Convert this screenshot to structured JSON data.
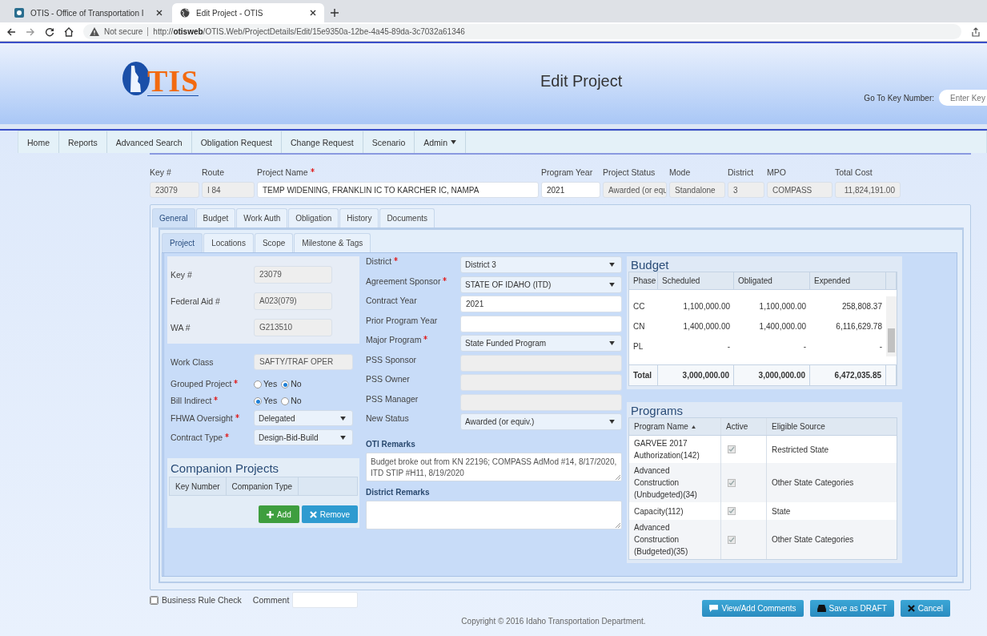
{
  "browser": {
    "tabs": [
      {
        "title": "OTIS - Office of Transportation I",
        "selected": false
      },
      {
        "title": "Edit Project - OTIS",
        "selected": true
      }
    ],
    "security": "Not secure",
    "url": "http://**otisweb**/OTIS.Web/ProjectDetails/Edit/15e9350a-12be-4a45-89da-3c7032a61346"
  },
  "header": {
    "logo_text": "TIS",
    "title": "Edit Project",
    "goto_label": "Go To Key Number:",
    "goto_placeholder": "Enter Key"
  },
  "nav": [
    {
      "label": "Home",
      "has_menu": false
    },
    {
      "label": "Reports",
      "has_menu": false
    },
    {
      "label": "Advanced Search",
      "has_menu": false
    },
    {
      "label": "Obligation Request",
      "has_menu": false
    },
    {
      "label": "Change Request",
      "has_menu": false
    },
    {
      "label": "Scenario",
      "has_menu": false
    },
    {
      "label": "Admin",
      "has_menu": true
    }
  ],
  "summary": [
    {
      "label": "Key #",
      "required": false,
      "value": "23079",
      "disabled": true
    },
    {
      "label": "Route",
      "required": false,
      "value": "I 84",
      "disabled": true
    },
    {
      "label": "Project Name",
      "required": true,
      "value": "TEMP WIDENING, FRANKLIN IC TO KARCHER IC, NAMPA",
      "disabled": false
    },
    {
      "label": "Program Year",
      "required": false,
      "value": "2021",
      "disabled": false
    },
    {
      "label": "Project Status",
      "required": false,
      "value": "Awarded (or equ",
      "disabled": true
    },
    {
      "label": "Mode",
      "required": false,
      "value": "Standalone",
      "disabled": true
    },
    {
      "label": "District",
      "required": false,
      "value": "3",
      "disabled": true
    },
    {
      "label": "MPO",
      "required": false,
      "value": "COMPASS",
      "disabled": true
    },
    {
      "label": "Total Cost",
      "required": false,
      "value": "11,824,191.00",
      "disabled": true
    }
  ],
  "tabs": [
    {
      "label": "General",
      "selected": true
    },
    {
      "label": "Budget",
      "selected": false
    },
    {
      "label": "Work Auth",
      "selected": false
    },
    {
      "label": "Obligation",
      "selected": false
    },
    {
      "label": "History",
      "selected": false
    },
    {
      "label": "Documents",
      "selected": false
    }
  ],
  "subtabs": [
    {
      "label": "Project",
      "selected": true
    },
    {
      "label": "Locations",
      "selected": false
    },
    {
      "label": "Scope",
      "selected": false
    },
    {
      "label": "Milestone & Tags",
      "selected": false
    }
  ],
  "id_fields": [
    {
      "label": "Key #",
      "value": "23079"
    },
    {
      "label": "Federal Aid #",
      "value": "A023(079)"
    },
    {
      "label": "WA #",
      "value": "G213510"
    }
  ],
  "left_fields": [
    {
      "kind": "readonly",
      "label": "Work Class",
      "required": false,
      "value": "SAFTY/TRAF OPER"
    },
    {
      "kind": "radio",
      "label": "Grouped Project",
      "required": true,
      "options": [
        {
          "label": "Yes",
          "selected": false
        },
        {
          "label": "No",
          "selected": true
        }
      ]
    },
    {
      "kind": "radio",
      "label": "Bill Indirect",
      "required": true,
      "options": [
        {
          "label": "Yes",
          "selected": true
        },
        {
          "label": "No",
          "selected": false
        }
      ]
    },
    {
      "kind": "select",
      "label": "FHWA Oversight",
      "required": true,
      "value": "Delegated"
    },
    {
      "kind": "select",
      "label": "Contract Type",
      "required": true,
      "value": "Design-Bid-Build"
    }
  ],
  "companion": {
    "title": "Companion Projects",
    "columns": [
      "Key Number",
      "Companion Type"
    ],
    "buttons": [
      {
        "kind": "add",
        "label": "Add"
      },
      {
        "kind": "remove",
        "label": "Remove"
      }
    ]
  },
  "middle_fields": [
    {
      "kind": "select",
      "label": "District",
      "required": true,
      "value": "District 3"
    },
    {
      "kind": "select",
      "label": "Agreement Sponsor",
      "required": true,
      "value": "STATE OF IDAHO (ITD)"
    },
    {
      "kind": "text",
      "label": "Contract Year",
      "required": false,
      "value": "2021"
    },
    {
      "kind": "text",
      "label": "Prior Program Year",
      "required": false
    },
    {
      "kind": "select",
      "label": "Major Program",
      "required": true,
      "value": "State Funded Program"
    },
    {
      "kind": "readonly",
      "label": "PSS Sponsor",
      "required": false
    },
    {
      "kind": "readonly",
      "label": "PSS Owner",
      "required": false
    },
    {
      "kind": "readonly",
      "label": "PSS Manager",
      "required": false
    },
    {
      "kind": "select",
      "label": "New Status",
      "required": false,
      "value": "Awarded (or equiv.)"
    }
  ],
  "remarks": [
    {
      "label": "OTI Remarks",
      "value": "Budget broke out from KN 22196; COMPASS AdMod #14, 8/17/2020, ITD STIP #H11, 8/19/2020"
    },
    {
      "label": "District Remarks"
    }
  ],
  "budget": {
    "title": "Budget",
    "columns": [
      "Phase",
      "Scheduled",
      "Obligated",
      "Expended"
    ],
    "rows": [
      [
        "CC",
        "1,100,000.00",
        "1,100,000.00",
        "258,808.37"
      ],
      [
        "CN",
        "1,400,000.00",
        "1,400,000.00",
        "6,116,629.78"
      ],
      [
        "PL",
        "-",
        "-",
        "-"
      ]
    ],
    "total": [
      "Total",
      "3,000,000.00",
      "3,000,000.00",
      "6,472,035.85"
    ]
  },
  "programs": {
    "title": "Programs",
    "columns": [
      "Program Name",
      "Active",
      "Eligible Source"
    ],
    "rows": [
      {
        "name": "GARVEE 2017 Authorization(142)",
        "active": true,
        "source": "Restricted State"
      },
      {
        "name": "Advanced Construction (Unbudgeted)(34)",
        "active": true,
        "source": "Other State Categories"
      },
      {
        "name": "Capacity(112)",
        "active": true,
        "source": "State"
      },
      {
        "name": "Advanced Construction (Budgeted)(35)",
        "active": true,
        "source": "Other State Categories"
      }
    ]
  },
  "footer": {
    "rule_check": {
      "label": "Business Rule Check",
      "checked": false
    },
    "comment_label": "Comment",
    "buttons": [
      {
        "kind": "comments",
        "label": "View/Add Comments"
      },
      {
        "kind": "save",
        "label": "Save as DRAFT"
      },
      {
        "kind": "cancel",
        "label": "Cancel"
      }
    ],
    "copyright": "Copyright © 2016 Idaho Transportation Department."
  }
}
